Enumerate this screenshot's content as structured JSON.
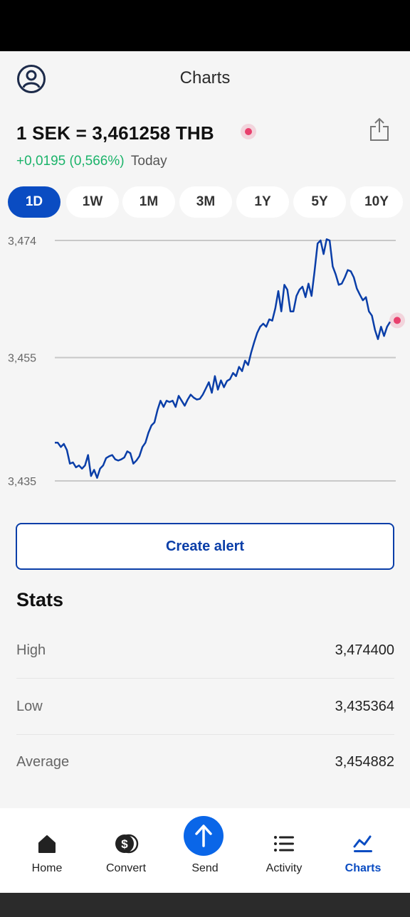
{
  "header": {
    "title": "Charts"
  },
  "rate": {
    "pair_text": "1 SEK = 3,461258 THB",
    "change": "+0,0195 (0,566%)",
    "period_label": "Today"
  },
  "periods": [
    {
      "label": "1D",
      "active": true
    },
    {
      "label": "1W",
      "active": false
    },
    {
      "label": "1M",
      "active": false
    },
    {
      "label": "3M",
      "active": false
    },
    {
      "label": "1Y",
      "active": false
    },
    {
      "label": "5Y",
      "active": false
    },
    {
      "label": "10Y",
      "active": false
    }
  ],
  "chart_data": {
    "type": "line",
    "title": "",
    "xlabel": "",
    "ylabel": "",
    "ylim": [
      3.435,
      3.474
    ],
    "yticks": [
      "3,474",
      "3,455",
      "3,435"
    ],
    "grid": true,
    "color": "#0a3ea8",
    "series": [
      {
        "values": [
          3.4412,
          3.4412,
          3.4405,
          3.441,
          3.44,
          3.4378,
          3.438,
          3.4372,
          3.4375,
          3.437,
          3.4375,
          3.4392,
          3.4358,
          3.4368,
          3.4355,
          3.437,
          3.4375,
          3.4387,
          3.439,
          3.4392,
          3.4385,
          3.4383,
          3.4385,
          3.4388,
          3.4398,
          3.4395,
          3.4378,
          3.4383,
          3.439,
          3.4405,
          3.4412,
          3.4428,
          3.444,
          3.4445,
          3.4465,
          3.448,
          3.447,
          3.448,
          3.4478,
          3.448,
          3.447,
          3.4488,
          3.448,
          3.4472,
          3.4482,
          3.449,
          3.4485,
          3.4482,
          3.4483,
          3.449,
          3.45,
          3.451,
          3.4493,
          3.452,
          3.4498,
          3.4513,
          3.4502,
          3.4512,
          3.4515,
          3.4525,
          3.452,
          3.4535,
          3.4528,
          3.4545,
          3.4538,
          3.4558,
          3.4575,
          3.459,
          3.46,
          3.4605,
          3.46,
          3.4612,
          3.461,
          3.463,
          3.4658,
          3.4625,
          3.4668,
          3.466,
          3.4625,
          3.4625,
          3.465,
          3.466,
          3.4665,
          3.4648,
          3.467,
          3.465,
          3.469,
          3.4735,
          3.474,
          3.4718,
          3.4742,
          3.474,
          3.4698,
          3.4685,
          3.4668,
          3.467,
          3.468,
          3.4692,
          3.469,
          3.468,
          3.4662,
          3.4652,
          3.4643,
          3.4648,
          3.4625,
          3.4618,
          3.4595,
          3.458,
          3.46,
          3.4585,
          3.46,
          3.4608
        ]
      }
    ]
  },
  "alert": {
    "label": "Create alert"
  },
  "stats": {
    "title": "Stats",
    "rows": [
      {
        "label": "High",
        "value": "3,474400"
      },
      {
        "label": "Low",
        "value": "3,435364"
      },
      {
        "label": "Average",
        "value": "3,454882"
      }
    ]
  },
  "nav": {
    "items": [
      {
        "label": "Home",
        "icon": "home-icon"
      },
      {
        "label": "Convert",
        "icon": "convert-icon"
      },
      {
        "label": "Send",
        "icon": "send-icon"
      },
      {
        "label": "Activity",
        "icon": "activity-icon"
      },
      {
        "label": "Charts",
        "icon": "charts-icon",
        "active": true
      }
    ]
  },
  "colors": {
    "accent": "#0a4cc2",
    "positive": "#1bb36a",
    "live_dot": "#e8406d"
  }
}
